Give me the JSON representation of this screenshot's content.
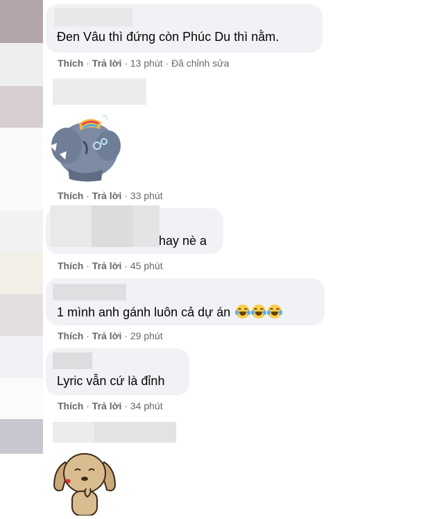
{
  "comments": [
    {
      "text": "Đen Vâu thì đứng còn Phúc Du thì nằm.",
      "like": "Thích",
      "reply": "Trả lời",
      "time": "13 phút",
      "edited": "Đã chỉnh sửa"
    },
    {
      "text": "",
      "sticker": "elephant-sticker",
      "like": "Thích",
      "reply": "Trả lời",
      "time": "33 phút"
    },
    {
      "text": "hay nè a",
      "like": "Thích",
      "reply": "Trả lời",
      "time": "45 phút"
    },
    {
      "text": "1 mình anh gánh luôn cả dự án",
      "emoji": "face-with-tears-of-joy-icon",
      "like": "Thích",
      "reply": "Trả lời",
      "time": "29 phút"
    },
    {
      "text": "Lyric vẫn cứ là đỉnh",
      "like": "Thích",
      "reply": "Trả lời",
      "time": "34 phút"
    },
    {
      "text": "",
      "sticker": "dog-sticker"
    }
  ],
  "separator": "·",
  "colors": {
    "bubble": "#f0f2f5",
    "action_text": "#65676b",
    "text": "#050505"
  }
}
